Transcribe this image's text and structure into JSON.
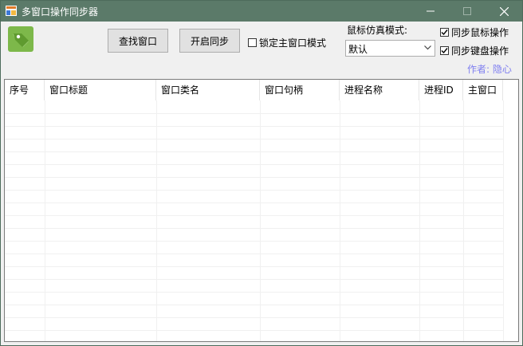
{
  "window": {
    "title": "多窗口操作同步器"
  },
  "toolbar": {
    "find_window_label": "查找窗口",
    "start_sync_label": "开启同步",
    "lock_main_label": "锁定主窗口模式",
    "lock_main_checked": false,
    "mouse_mode_label": "鼠标仿真模式:",
    "mouse_mode_value": "默认",
    "sync_mouse_label": "同步鼠标操作",
    "sync_mouse_checked": true,
    "sync_keyboard_label": "同步键盘操作",
    "sync_keyboard_checked": true,
    "author_label": "作者: 隐心"
  },
  "table": {
    "columns": [
      "序号",
      "窗口标题",
      "窗口类名",
      "窗口句柄",
      "进程名称",
      "进程ID",
      "主窗口"
    ],
    "rows": []
  },
  "icons": {
    "app_icon": "app-window-icon",
    "logo": "tag-logo-icon",
    "minimize": "minimize-icon",
    "maximize": "maximize-icon",
    "close": "close-icon",
    "dropdown": "chevron-down-icon",
    "check": "check-icon"
  },
  "colors": {
    "titlebar": "#5b7a69",
    "client": "#f0f0f0",
    "author": "#7f7ff0",
    "logo": "#7db84a"
  }
}
